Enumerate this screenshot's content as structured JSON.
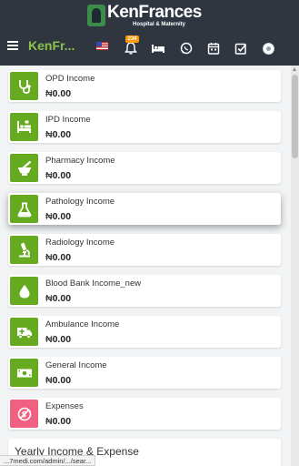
{
  "logo": {
    "name": "KenFrances",
    "subtitle": "Hospital & Maternity"
  },
  "navbar": {
    "brand": "KenFr...",
    "notification_count": "234",
    "icons": [
      "menu-icon",
      "us-flag-icon",
      "bell-icon",
      "bed-icon",
      "whatsapp-icon",
      "calendar-icon",
      "checkbox-icon",
      "avatar"
    ]
  },
  "cards": [
    {
      "title": "OPD Income",
      "currency": "₦",
      "amount": "0.00",
      "icon": "stethoscope-icon",
      "color": "#66aa1f"
    },
    {
      "title": "IPD Income",
      "currency": "₦",
      "amount": "0.00",
      "icon": "hospital-bed-icon",
      "color": "#66aa1f"
    },
    {
      "title": "Pharmacy Income",
      "currency": "₦",
      "amount": "0.00",
      "icon": "mortar-pestle-icon",
      "color": "#66aa1f"
    },
    {
      "title": "Pathology Income",
      "currency": "₦",
      "amount": "0.00",
      "icon": "flask-icon",
      "color": "#66aa1f"
    },
    {
      "title": "Radiology Income",
      "currency": "₦",
      "amount": "0.00",
      "icon": "microscope-icon",
      "color": "#66aa1f"
    },
    {
      "title": "Blood Bank Income_new",
      "currency": "₦",
      "amount": "0.00",
      "icon": "blood-drop-icon",
      "color": "#66aa1f"
    },
    {
      "title": "Ambulance Income",
      "currency": "₦",
      "amount": "0.00",
      "icon": "ambulance-icon",
      "color": "#66aa1f"
    },
    {
      "title": "General Income",
      "currency": "₦",
      "amount": "0.00",
      "icon": "money-icon",
      "color": "#66aa1f"
    },
    {
      "title": "Expenses",
      "currency": "₦",
      "amount": "0.00",
      "icon": "expense-icon",
      "color": "#f06181"
    }
  ],
  "yearly": {
    "title": "Yearly Income & Expense"
  },
  "status_bar": {
    "url": "...7medi.com/admin/.../sear..."
  }
}
